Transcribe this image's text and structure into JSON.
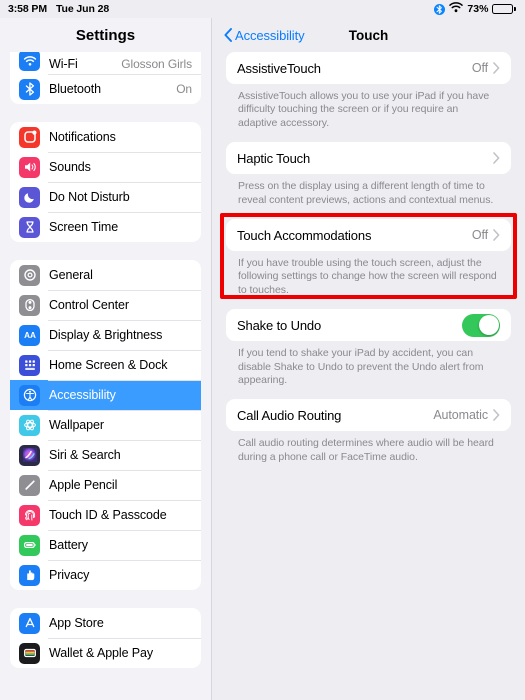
{
  "status_bar": {
    "time": "3:58 PM",
    "date": "Tue Jun 28",
    "battery_percent": "73%",
    "battery_level": 73,
    "bluetooth_icon": "bluetooth-icon",
    "wifi_icon": "wifi-icon",
    "battery_icon": "battery-icon"
  },
  "sidebar": {
    "title": "Settings",
    "groups": [
      {
        "items": [
          {
            "label": "Wi-Fi",
            "value": "Glosson Girls",
            "icon": "wifi-icon",
            "icon_color": "#1b7ef5",
            "selected": false,
            "clipped": true
          },
          {
            "label": "Bluetooth",
            "value": "On",
            "icon": "bluetooth-icon",
            "icon_color": "#1b7ef5",
            "selected": false
          }
        ]
      },
      {
        "items": [
          {
            "label": "Notifications",
            "value": "",
            "icon": "notifications-icon",
            "icon_color": "#f5372b",
            "selected": false
          },
          {
            "label": "Sounds",
            "value": "",
            "icon": "sounds-icon",
            "icon_color": "#f4386a",
            "selected": false
          },
          {
            "label": "Do Not Disturb",
            "value": "",
            "icon": "moon-icon",
            "icon_color": "#5a56d6",
            "selected": false
          },
          {
            "label": "Screen Time",
            "value": "",
            "icon": "hourglass-icon",
            "icon_color": "#5a56d6",
            "selected": false
          }
        ]
      },
      {
        "items": [
          {
            "label": "General",
            "value": "",
            "icon": "gear-icon",
            "icon_color": "#8e8e93",
            "selected": false
          },
          {
            "label": "Control Center",
            "value": "",
            "icon": "sliders-icon",
            "icon_color": "#8e8e93",
            "selected": false
          },
          {
            "label": "Display & Brightness",
            "value": "",
            "icon": "text-size-icon",
            "icon_color": "#1b7ef5",
            "selected": false
          },
          {
            "label": "Home Screen & Dock",
            "value": "",
            "icon": "home-screen-icon",
            "icon_color": "#3b4fd8",
            "selected": false
          },
          {
            "label": "Accessibility",
            "value": "",
            "icon": "accessibility-icon",
            "icon_color": "#1b7ef5",
            "selected": true
          },
          {
            "label": "Wallpaper",
            "value": "",
            "icon": "wallpaper-icon",
            "icon_color": "#3fc8e8",
            "selected": false
          },
          {
            "label": "Siri & Search",
            "value": "",
            "icon": "siri-icon",
            "icon_color": "#2b2b47",
            "selected": false
          },
          {
            "label": "Apple Pencil",
            "value": "",
            "icon": "pencil-icon",
            "icon_color": "#8e8e93",
            "selected": false
          },
          {
            "label": "Touch ID & Passcode",
            "value": "",
            "icon": "fingerprint-icon",
            "icon_color": "#f4386a",
            "selected": false
          },
          {
            "label": "Battery",
            "value": "",
            "icon": "battery-icon",
            "icon_color": "#32c85a",
            "selected": false
          },
          {
            "label": "Privacy",
            "value": "",
            "icon": "hand-icon",
            "icon_color": "#1b7ef5",
            "selected": false
          }
        ]
      },
      {
        "items": [
          {
            "label": "App Store",
            "value": "",
            "icon": "app-store-icon",
            "icon_color": "#1b7ef5",
            "selected": false
          },
          {
            "label": "Wallet & Apple Pay",
            "value": "",
            "icon": "wallet-icon",
            "icon_color": "#1c1c1e",
            "selected": false
          }
        ]
      }
    ]
  },
  "detail": {
    "back_label": "Accessibility",
    "title": "Touch",
    "sections": [
      {
        "name": "assistive-touch",
        "label": "AssistiveTouch",
        "value": "Off",
        "control": "chevron",
        "footnote": "AssistiveTouch allows you to use your iPad if you have difficulty touching the screen or if you require an adaptive accessory."
      },
      {
        "name": "haptic-touch",
        "label": "Haptic Touch",
        "value": "",
        "control": "chevron",
        "footnote": "Press on the display using a different length of time to reveal content previews, actions and contextual menus."
      },
      {
        "name": "touch-accommodations",
        "label": "Touch Accommodations",
        "value": "Off",
        "control": "chevron",
        "footnote": "If you have trouble using the touch screen, adjust the following settings to change how the screen will respond to touches.",
        "highlighted": true
      },
      {
        "name": "shake-to-undo",
        "label": "Shake to Undo",
        "value": "",
        "control": "toggle",
        "toggle_on": true,
        "footnote": "If you tend to shake your iPad by accident, you can disable Shake to Undo to prevent the Undo alert from appearing."
      },
      {
        "name": "call-audio-routing",
        "label": "Call Audio Routing",
        "value": "Automatic",
        "control": "chevron",
        "footnote": "Call audio routing determines where audio will be heard during a phone call or FaceTime audio."
      }
    ]
  },
  "annotation": {
    "highlight_color": "#ef0000",
    "target": "touch-accommodations"
  }
}
